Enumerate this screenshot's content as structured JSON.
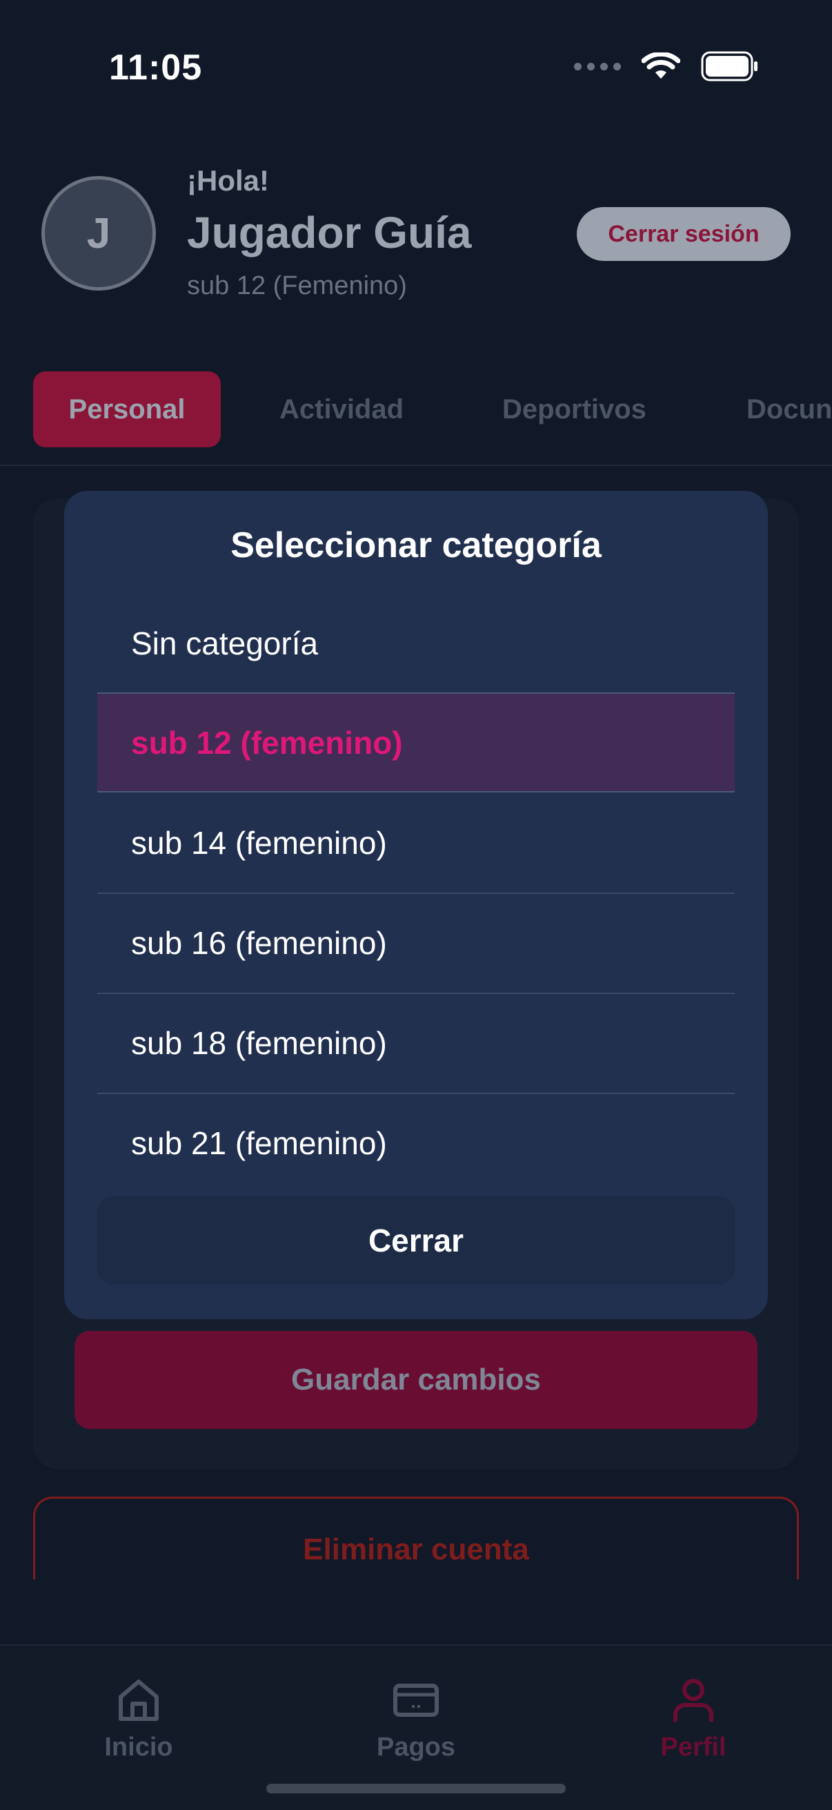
{
  "status_bar": {
    "time": "11:05"
  },
  "header": {
    "avatar_initial": "J",
    "greeting": "¡Hola!",
    "name": "Jugador Guía",
    "category": "sub 12 (Femenino)",
    "logout_label": "Cerrar sesión"
  },
  "tabs": [
    {
      "label": "Personal",
      "active": true
    },
    {
      "label": "Actividad",
      "active": false
    },
    {
      "label": "Deportivos",
      "active": false
    },
    {
      "label": "Docun",
      "active": false
    }
  ],
  "form": {
    "save_label": "Guardar cambios",
    "delete_label": "Eliminar cuenta"
  },
  "modal": {
    "title": "Seleccionar categoría",
    "options": [
      {
        "label": "Sin categoría",
        "selected": false
      },
      {
        "label": "sub 12 (femenino)",
        "selected": true
      },
      {
        "label": "sub 14 (femenino)",
        "selected": false
      },
      {
        "label": "sub 16 (femenino)",
        "selected": false
      },
      {
        "label": "sub 18 (femenino)",
        "selected": false
      },
      {
        "label": "sub 21 (femenino)",
        "selected": false
      }
    ],
    "close_label": "Cerrar"
  },
  "bottom_nav": [
    {
      "label": "Inicio",
      "icon": "home-icon",
      "active": false
    },
    {
      "label": "Pagos",
      "icon": "card-icon",
      "active": false
    },
    {
      "label": "Perfil",
      "icon": "user-icon",
      "active": true
    }
  ],
  "colors": {
    "accent": "#e0177a",
    "accent_dark": "#8a1538",
    "background": "#111827",
    "modal": "#22304f"
  }
}
